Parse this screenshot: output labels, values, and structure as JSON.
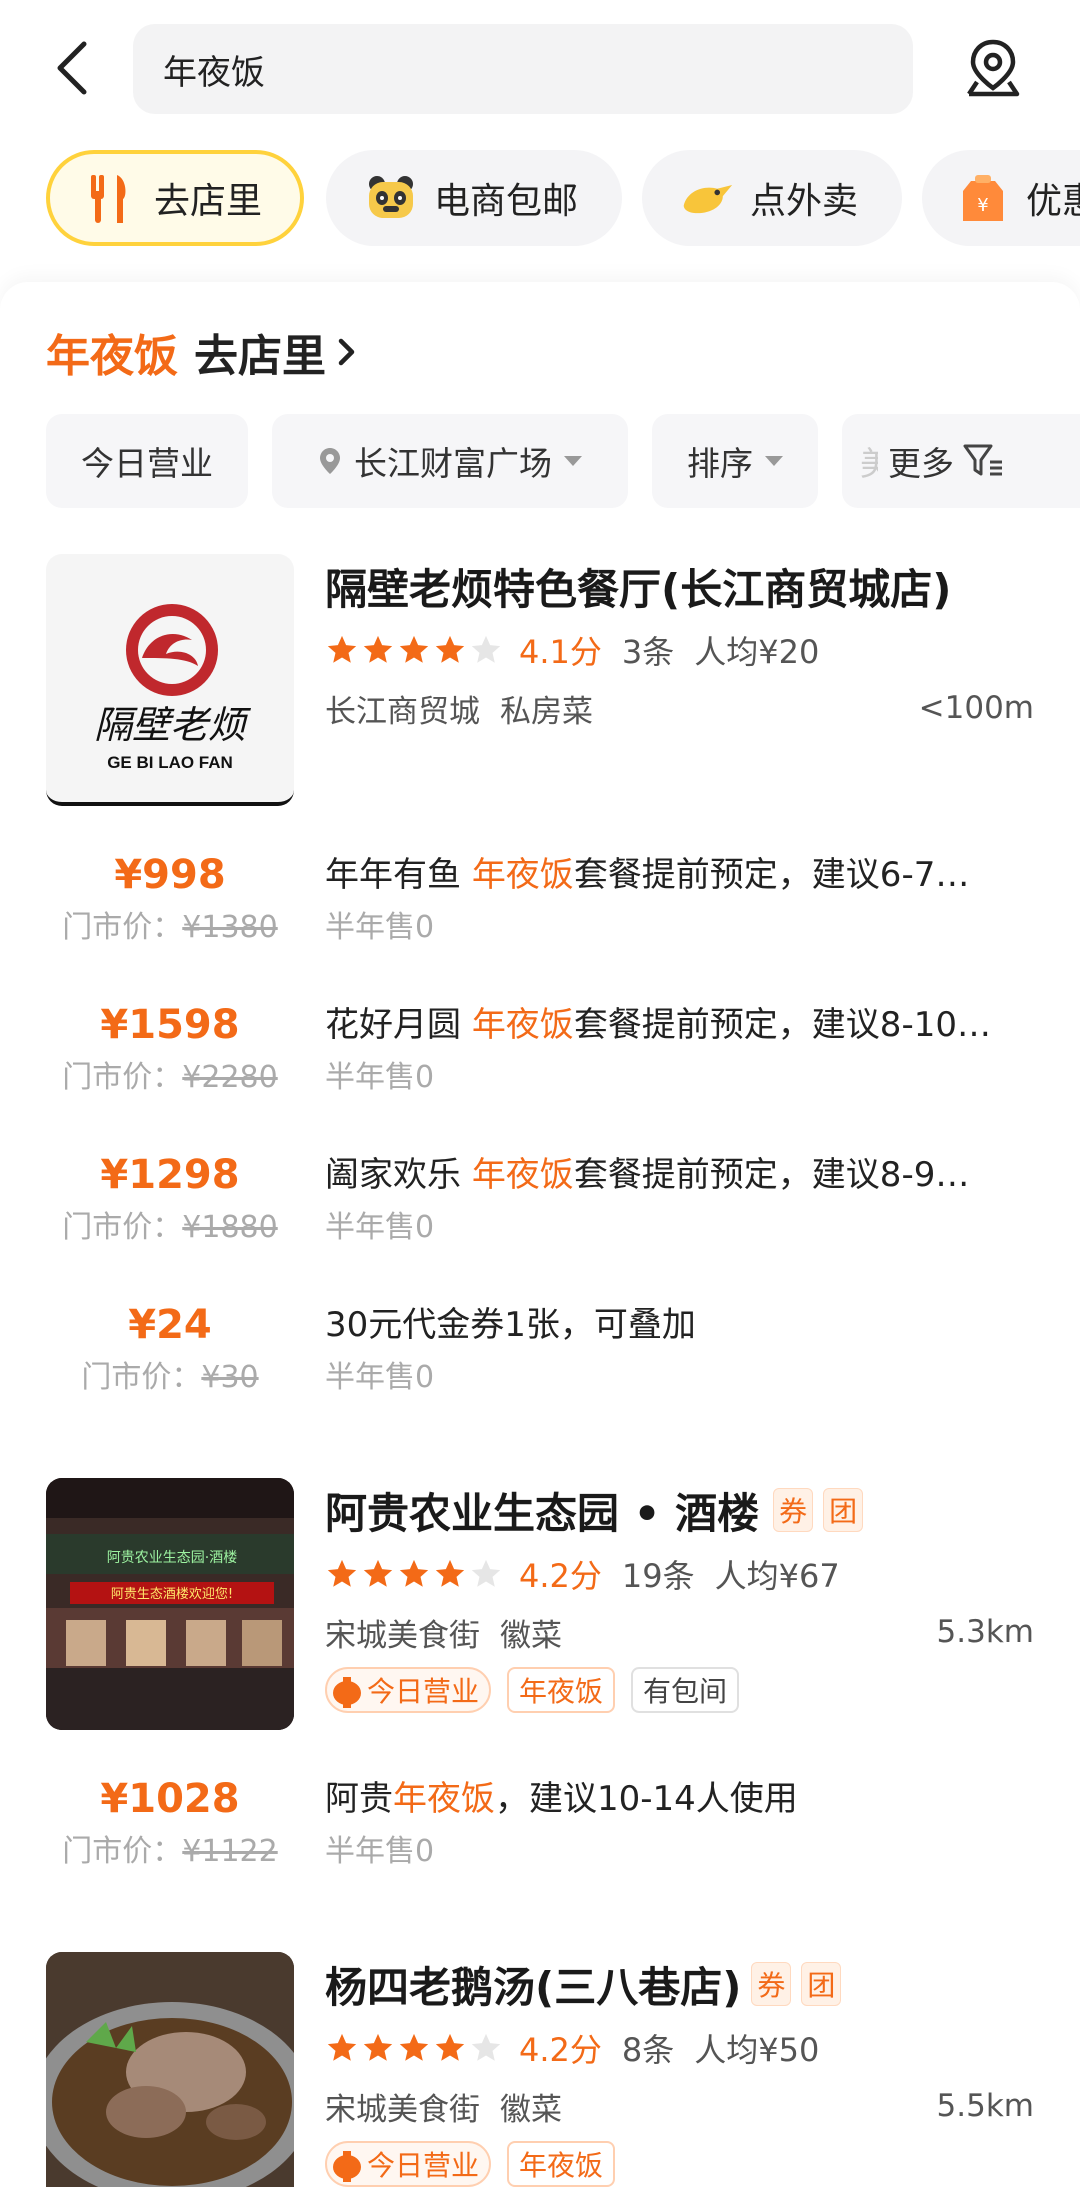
{
  "search": {
    "query": "年夜饭"
  },
  "categories": [
    {
      "label": "去店里",
      "icon": "fork-knife-icon",
      "active": true
    },
    {
      "label": "电商包邮",
      "icon": "panda-icon",
      "active": false
    },
    {
      "label": "点外卖",
      "icon": "delivery-duck-icon",
      "active": false
    },
    {
      "label": "优惠",
      "icon": "coupon-bag-icon",
      "active": false
    }
  ],
  "section": {
    "keyword": "年夜饭",
    "title": "去店里",
    "arrow": "›"
  },
  "filters": {
    "open_today": "今日营业",
    "location": "长江财富广场",
    "sort": "排序",
    "more_partial": "美",
    "more": "更多"
  },
  "colors": {
    "accent": "#f36a17",
    "chip_active_border": "#ffd23c"
  },
  "shops": [
    {
      "name": "隔壁老烦特色餐厅(长江商贸城店)",
      "logo_text": "GE BI LAO FAN",
      "logo_cn": "隔壁老烦",
      "stars": 4,
      "score": "4.1分",
      "reviews": "3条",
      "avg_price": "人均¥20",
      "area": "长江商贸城",
      "cuisine": "私房菜",
      "distance": "<100m",
      "deals": [
        {
          "price": "¥998",
          "orig_label": "门市价：",
          "orig_price": "¥1380",
          "title_pre": "年年有鱼 ",
          "title_hl": "年夜饭",
          "title_post": "套餐提前预定，建议6-7…",
          "sold": "半年售0"
        },
        {
          "price": "¥1598",
          "orig_label": "门市价：",
          "orig_price": "¥2280",
          "title_pre": "花好月圆 ",
          "title_hl": "年夜饭",
          "title_post": "套餐提前预定，建议8-10…",
          "sold": "半年售0"
        },
        {
          "price": "¥1298",
          "orig_label": "门市价：",
          "orig_price": "¥1880",
          "title_pre": "阖家欢乐 ",
          "title_hl": "年夜饭",
          "title_post": "套餐提前预定，建议8-9…",
          "sold": "半年售0"
        },
        {
          "price": "¥24",
          "orig_label": "门市价：",
          "orig_price": "¥30",
          "title_pre": "30元代金券1张，可叠加",
          "title_hl": "",
          "title_post": "",
          "sold": "半年售0"
        }
      ]
    },
    {
      "name": "阿贵农业生态园 • 酒楼",
      "tag_quan": "券",
      "tag_tuan": "团",
      "sign_top": "阿贵农业生态园·酒楼",
      "sign_led": "阿贵生态酒楼欢迎您!",
      "stars": 4,
      "score": "4.2分",
      "reviews": "19条",
      "avg_price": "人均¥67",
      "area": "宋城美食街",
      "cuisine": "徽菜",
      "distance": "5.3km",
      "badge_today": "今日营业",
      "badge_nyf": "年夜饭",
      "badge_room": "有包间",
      "deals": [
        {
          "price": "¥1028",
          "orig_label": "门市价：",
          "orig_price": "¥1122",
          "title_pre": "阿贵",
          "title_hl": "年夜饭",
          "title_post": "，建议10-14人使用",
          "sold": "半年售0"
        }
      ]
    },
    {
      "name": "杨四老鹅汤(三八巷店)",
      "tag_quan": "券",
      "tag_tuan": "团",
      "stars": 4,
      "score": "4.2分",
      "reviews": "8条",
      "avg_price": "人均¥50",
      "area": "宋城美食街",
      "cuisine": "徽菜",
      "distance": "5.5km",
      "badge_today": "今日营业",
      "badge_nyf": "年夜饭"
    }
  ]
}
